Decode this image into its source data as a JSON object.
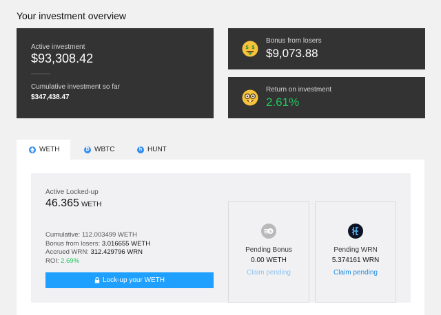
{
  "header": {
    "title": "Your investment overview"
  },
  "overview": {
    "active_label": "Active investment",
    "active_value": "$93,308.42",
    "cumulative_label": "Cumulative investment so far",
    "cumulative_value": "$347,438.47",
    "bonus_label": "Bonus from losers",
    "bonus_value": "$9,073.88",
    "roi_label": "Return on investment",
    "roi_value": "2.61%",
    "roi_color": "#22c55e"
  },
  "tabs": [
    {
      "label": "WETH",
      "icon": "ethereum-icon",
      "active": true
    },
    {
      "label": "WBTC",
      "icon": "bitcoin-icon",
      "active": false
    },
    {
      "label": "HUNT",
      "icon": "hunt-icon",
      "active": false
    }
  ],
  "panel": {
    "locked_label": "Active Locked-up",
    "locked_value": "46.365",
    "locked_unit": "WETH",
    "cumulative_label": "Cumulative:",
    "cumulative_value": "112.003499 WETH",
    "bonus_label": "Bonus from losers:",
    "bonus_value": "3.016655 WETH",
    "accrued_label": "Accrued WRN:",
    "accrued_value": "312.429796 WRN",
    "roi_label": "ROI:",
    "roi_value": "2.69%",
    "lock_button": "Lock-up your WETH",
    "pending_bonus": {
      "title": "Pending Bonus",
      "value": "0.00 WETH",
      "claim": "Claim pending"
    },
    "pending_wrn": {
      "title": "Pending WRN",
      "value": "5.374161 WRN",
      "claim": "Claim pending"
    }
  },
  "colors": {
    "accent": "#1fa0ff",
    "card_bg": "#333333",
    "green": "#22c55e"
  }
}
